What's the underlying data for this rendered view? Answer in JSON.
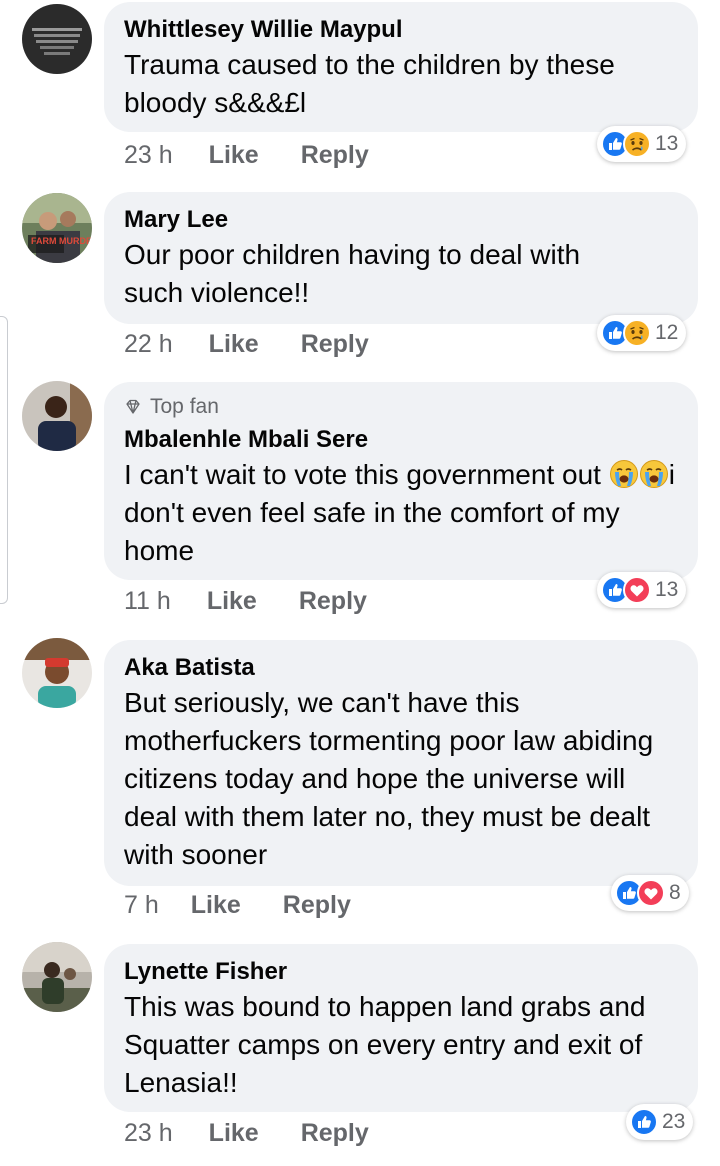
{
  "comments": [
    {
      "author": "Whittlesey Willie Maypul",
      "text": "Trauma caused to the children by these bloody s&&&£l",
      "time": "23 h",
      "like": "Like",
      "reply": "Reply",
      "reactions": [
        "like-icon",
        "sad-icon"
      ],
      "reaction_count": "13"
    },
    {
      "author": "Mary Lee",
      "avatar_caption": "FARM MURDERS",
      "text": "Our poor children having to deal with such violence!!",
      "time": "22 h",
      "like": "Like",
      "reply": "Reply",
      "reactions": [
        "like-icon",
        "sad-icon"
      ],
      "reaction_count": "12"
    },
    {
      "badge": "Top fan",
      "author": "Mbalenhle Mbali Sere",
      "text_before": "I can't wait to vote this government out",
      "text_after": "i don't even feel safe in the comfort of my home",
      "inline_emoji": [
        "loudly-crying-face-icon",
        "loudly-crying-face-icon"
      ],
      "time": "11 h",
      "like": "Like",
      "reply": "Reply",
      "reactions": [
        "like-icon",
        "love-icon"
      ],
      "reaction_count": "13"
    },
    {
      "author": "Aka Batista",
      "text": "But seriously, we can't have this motherfuckers tormenting poor law abiding citizens today and hope the universe will deal with them later no, they must be dealt with sooner",
      "time": "7 h",
      "like": "Like",
      "reply": "Reply",
      "reactions": [
        "like-icon",
        "love-icon"
      ],
      "reaction_count": "8"
    },
    {
      "author": "Lynette Fisher",
      "text": "This was bound to happen  land grabs and Squatter camps  on every entry and exit of Lenasia!!",
      "time": "23 h",
      "like": "Like",
      "reply": "Reply",
      "reactions": [
        "like-icon"
      ],
      "reaction_count": "23"
    }
  ],
  "colors": {
    "bubble": "#f0f2f5",
    "like_blue": "#1877f2",
    "love_red": "#f33e58",
    "sad_yellow": "#f7b125",
    "meta_gray": "#65676b"
  }
}
